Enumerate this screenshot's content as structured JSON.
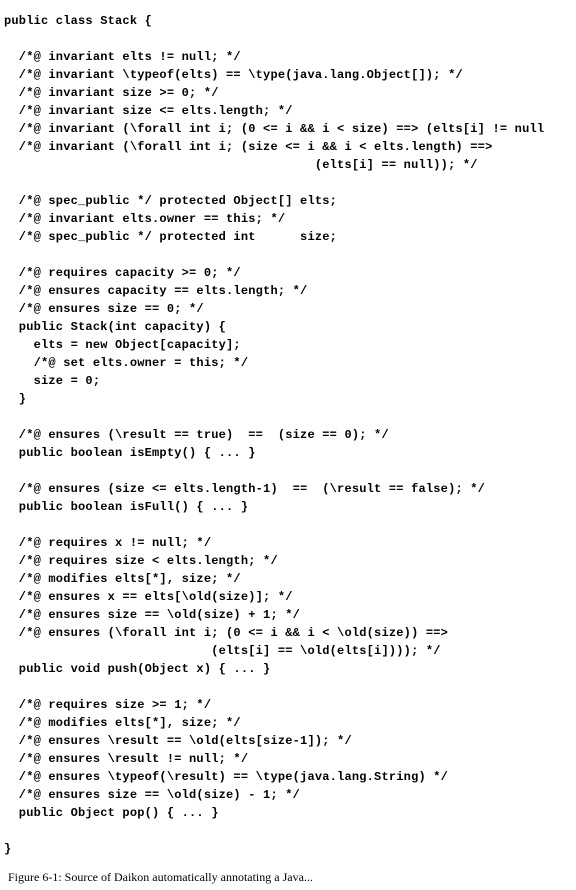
{
  "code": {
    "l01": "public class Stack {",
    "l02": "",
    "l03": "  /*@ invariant elts != null; */",
    "l04": "  /*@ invariant \\typeof(elts) == \\type(java.lang.Object[]); */",
    "l05": "  /*@ invariant size >= 0; */",
    "l06": "  /*@ invariant size <= elts.length; */",
    "l07": "  /*@ invariant (\\forall int i; (0 <= i && i < size) ==> (elts[i] != null",
    "l08": "  /*@ invariant (\\forall int i; (size <= i && i < elts.length) ==>",
    "l09": "                                          (elts[i] == null)); */",
    "l10": "",
    "l11": "  /*@ spec_public */ protected Object[] elts;",
    "l12": "  /*@ invariant elts.owner == this; */",
    "l13": "  /*@ spec_public */ protected int      size;",
    "l14": "",
    "l15": "  /*@ requires capacity >= 0; */",
    "l16": "  /*@ ensures capacity == elts.length; */",
    "l17": "  /*@ ensures size == 0; */",
    "l18": "  public Stack(int capacity) {",
    "l19": "    elts = new Object[capacity];",
    "l20": "    /*@ set elts.owner = this; */",
    "l21": "    size = 0;",
    "l22": "  }",
    "l23": "",
    "l24": "  /*@ ensures (\\result == true)  ==  (size == 0); */",
    "l25": "  public boolean isEmpty() { ... }",
    "l26": "",
    "l27": "  /*@ ensures (size <= elts.length-1)  ==  (\\result == false); */",
    "l28": "  public boolean isFull() { ... }",
    "l29": "",
    "l30": "  /*@ requires x != null; */",
    "l31": "  /*@ requires size < elts.length; */",
    "l32": "  /*@ modifies elts[*], size; */",
    "l33": "  /*@ ensures x == elts[\\old(size)]; */",
    "l34": "  /*@ ensures size == \\old(size) + 1; */",
    "l35": "  /*@ ensures (\\forall int i; (0 <= i && i < \\old(size)) ==>",
    "l36": "                            (elts[i] == \\old(elts[i]))); */",
    "l37": "  public void push(Object x) { ... }",
    "l38": "",
    "l39": "  /*@ requires size >= 1; */",
    "l40": "  /*@ modifies elts[*], size; */",
    "l41": "  /*@ ensures \\result == \\old(elts[size-1]); */",
    "l42": "  /*@ ensures \\result != null; */",
    "l43": "  /*@ ensures \\typeof(\\result) == \\type(java.lang.String) */",
    "l44": "  /*@ ensures size == \\old(size) - 1; */",
    "l45": "  public Object pop() { ... }",
    "l46": "",
    "l47": "}"
  },
  "caption": "Figure 6-1: Source of Daikon automatically annotating a Java..."
}
